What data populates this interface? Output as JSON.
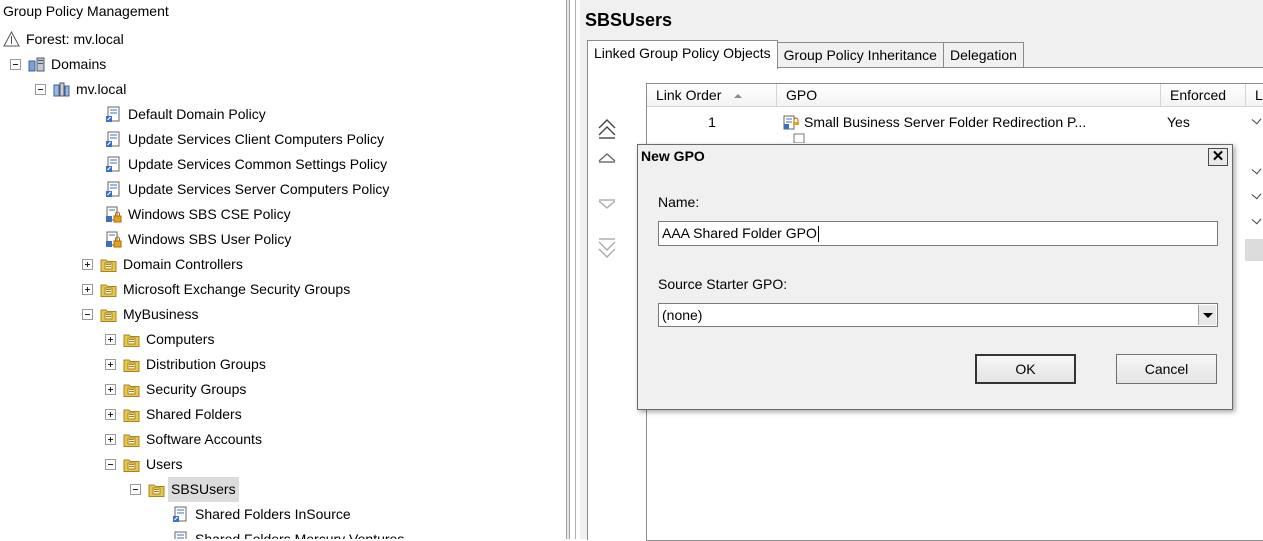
{
  "tree": {
    "title": "Group Policy Management",
    "items": [
      {
        "label": "Forest: mv.local",
        "level": 0,
        "exp": "",
        "icon": "forest"
      },
      {
        "label": "Domains",
        "level": 1,
        "exp": "minus",
        "icon": "domains"
      },
      {
        "label": "mv.local",
        "level": 2,
        "exp": "minus",
        "icon": "domain"
      },
      {
        "label": "Default Domain Policy",
        "level": 4,
        "exp": "",
        "icon": "gpo-link"
      },
      {
        "label": "Update Services Client Computers Policy",
        "level": 4,
        "exp": "",
        "icon": "gpo-link"
      },
      {
        "label": "Update Services Common Settings Policy",
        "level": 4,
        "exp": "",
        "icon": "gpo-link"
      },
      {
        "label": "Update Services Server Computers Policy",
        "level": 4,
        "exp": "",
        "icon": "gpo-link"
      },
      {
        "label": "Windows SBS CSE Policy",
        "level": 4,
        "exp": "",
        "icon": "gpo-enforced"
      },
      {
        "label": "Windows SBS User Policy",
        "level": 4,
        "exp": "",
        "icon": "gpo-enforced"
      },
      {
        "label": "Domain Controllers",
        "level": 3,
        "exp": "plus",
        "icon": "ou"
      },
      {
        "label": "Microsoft Exchange Security Groups",
        "level": 3,
        "exp": "plus",
        "icon": "ou"
      },
      {
        "label": "MyBusiness",
        "level": 3,
        "exp": "minus",
        "icon": "ou"
      },
      {
        "label": "Computers",
        "level": 4,
        "exp": "plus",
        "icon": "ou"
      },
      {
        "label": "Distribution Groups",
        "level": 4,
        "exp": "plus",
        "icon": "ou"
      },
      {
        "label": "Security Groups",
        "level": 4,
        "exp": "plus",
        "icon": "ou"
      },
      {
        "label": "Shared Folders",
        "level": 4,
        "exp": "plus",
        "icon": "ou"
      },
      {
        "label": "Software Accounts",
        "level": 4,
        "exp": "plus",
        "icon": "ou"
      },
      {
        "label": "Users",
        "level": 4,
        "exp": "minus",
        "icon": "ou"
      },
      {
        "label": "SBSUsers",
        "level": 5,
        "exp": "minus",
        "icon": "ou",
        "selected": true
      },
      {
        "label": "Shared Folders InSource",
        "level": 7,
        "exp": "",
        "icon": "gpo-link"
      },
      {
        "label": "Shared Folders Mercury Ventures",
        "level": 7,
        "exp": "",
        "icon": "gpo-link"
      }
    ]
  },
  "pane": {
    "title": "SBSUsers",
    "tabs": [
      "Linked Group Policy Objects",
      "Group Policy Inheritance",
      "Delegation"
    ],
    "columns": [
      "Link Order",
      "GPO",
      "Enforced",
      "L"
    ],
    "rows": [
      {
        "order": "1",
        "gpo": "Small Business Server Folder Redirection P...",
        "enforced": "Yes"
      }
    ]
  },
  "dialog": {
    "title": "New GPO",
    "close": "✕",
    "name_label": "Name:",
    "name_value": "AAA Shared Folder GPO",
    "starter_label": "Source Starter GPO:",
    "starter_value": "(none)",
    "ok": "OK",
    "cancel": "Cancel"
  },
  "colors": {
    "ou_folder": "#e8c84a",
    "gpo_blue": "#3a6fc4",
    "selection": "#dcdcdc"
  }
}
